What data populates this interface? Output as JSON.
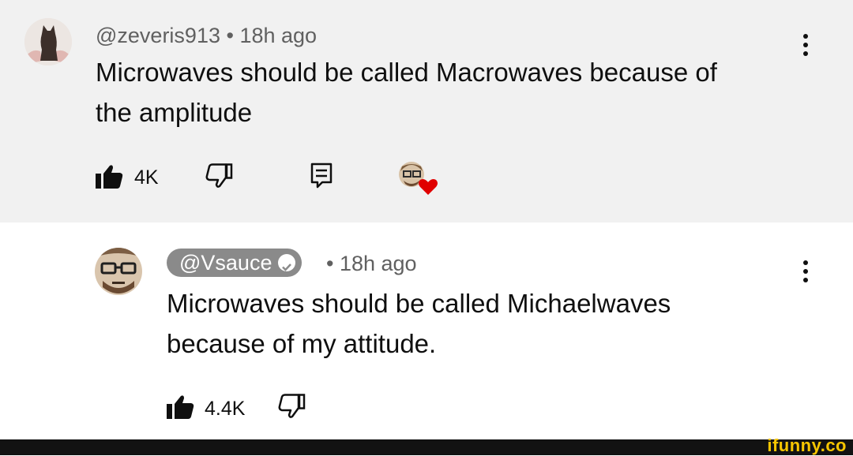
{
  "comment": {
    "author": "@zeveris913",
    "separator": "•",
    "time": "18h ago",
    "text_line1": "Microwaves should be called Macrowaves because of",
    "text_line2": "the amplitude",
    "likes": "4K",
    "avatar_icon": "cat-avatar-icon",
    "heart_color": "#e00000"
  },
  "reply": {
    "author": "@Vsauce",
    "separator": "•",
    "time": "18h ago",
    "text_line1": "Microwaves should be called Michaelwaves",
    "text_line2": "because of my attitude.",
    "likes": "4.4K",
    "avatar_icon": "face-with-glasses-avatar-icon",
    "verified_icon": "verified-check-icon"
  },
  "watermark": "ifunny.co"
}
